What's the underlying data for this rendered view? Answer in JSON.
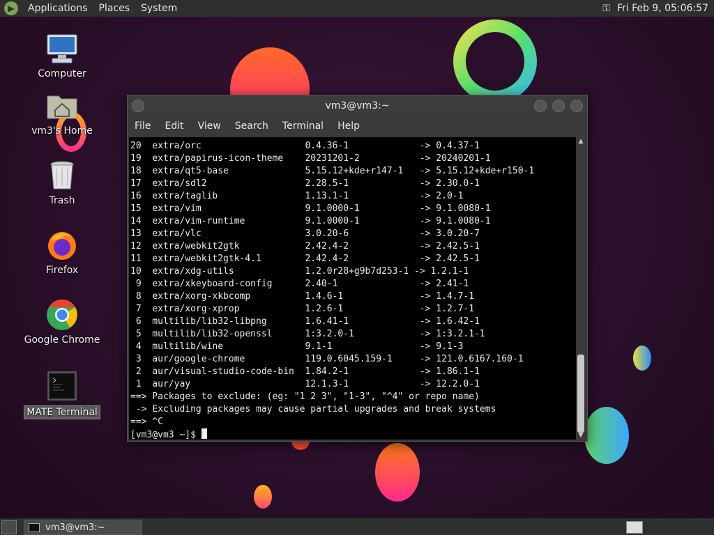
{
  "top_panel": {
    "menus": [
      "Applications",
      "Places",
      "System"
    ],
    "clock": "Fri Feb  9, 05:06:57"
  },
  "desktop_icons": [
    {
      "label": "Computer",
      "icon": "computer-icon"
    },
    {
      "label": "vm3's Home",
      "icon": "home-folder-icon"
    },
    {
      "label": "Trash",
      "icon": "trash-icon"
    },
    {
      "label": "Firefox",
      "icon": "firefox-icon"
    },
    {
      "label": "Google Chrome",
      "icon": "chrome-icon"
    },
    {
      "label": "MATE Terminal",
      "icon": "terminal-icon"
    }
  ],
  "window": {
    "title": "vm3@vm3:~",
    "menu": [
      "File",
      "Edit",
      "View",
      "Search",
      "Terminal",
      "Help"
    ],
    "lines": [
      "20  extra/orc                   0.4.36-1             -> 0.4.37-1",
      "19  extra/papirus-icon-theme    20231201-2           -> 20240201-1",
      "18  extra/qt5-base              5.15.12+kde+r147-1   -> 5.15.12+kde+r150-1",
      "17  extra/sdl2                  2.28.5-1             -> 2.30.0-1",
      "16  extra/taglib                1.13.1-1             -> 2.0-1",
      "15  extra/vim                   9.1.0000-1           -> 9.1.0080-1",
      "14  extra/vim-runtime           9.1.0000-1           -> 9.1.0080-1",
      "13  extra/vlc                   3.0.20-6             -> 3.0.20-7",
      "12  extra/webkit2gtk            2.42.4-2             -> 2.42.5-1",
      "11  extra/webkit2gtk-4.1        2.42.4-2             -> 2.42.5-1",
      "10  extra/xdg-utils             1.2.0r28+g9b7d253-1 -> 1.2.1-1",
      " 9  extra/xkeyboard-config      2.40-1               -> 2.41-1",
      " 8  extra/xorg-xkbcomp          1.4.6-1              -> 1.4.7-1",
      " 7  extra/xorg-xprop            1.2.6-1              -> 1.2.7-1",
      " 6  multilib/lib32-libpng       1.6.41-1             -> 1.6.42-1",
      " 5  multilib/lib32-openssl      1:3.2.0-1            -> 1:3.2.1-1",
      " 4  multilib/wine               9.1-1                -> 9.1-3",
      " 3  aur/google-chrome           119.0.6045.159-1     -> 121.0.6167.160-1",
      " 2  aur/visual-studio-code-bin  1.84.2-1             -> 1.86.1-1",
      " 1  aur/yay                     12.1.3-1             -> 12.2.0-1",
      "==> Packages to exclude: (eg: \"1 2 3\", \"1-3\", \"^4\" or repo name)",
      " -> Excluding packages may cause partial upgrades and break systems",
      "==> ^C"
    ],
    "prompt": "[vm3@vm3 ~]$ "
  },
  "taskbar": {
    "task_label": "vm3@vm3:~"
  }
}
